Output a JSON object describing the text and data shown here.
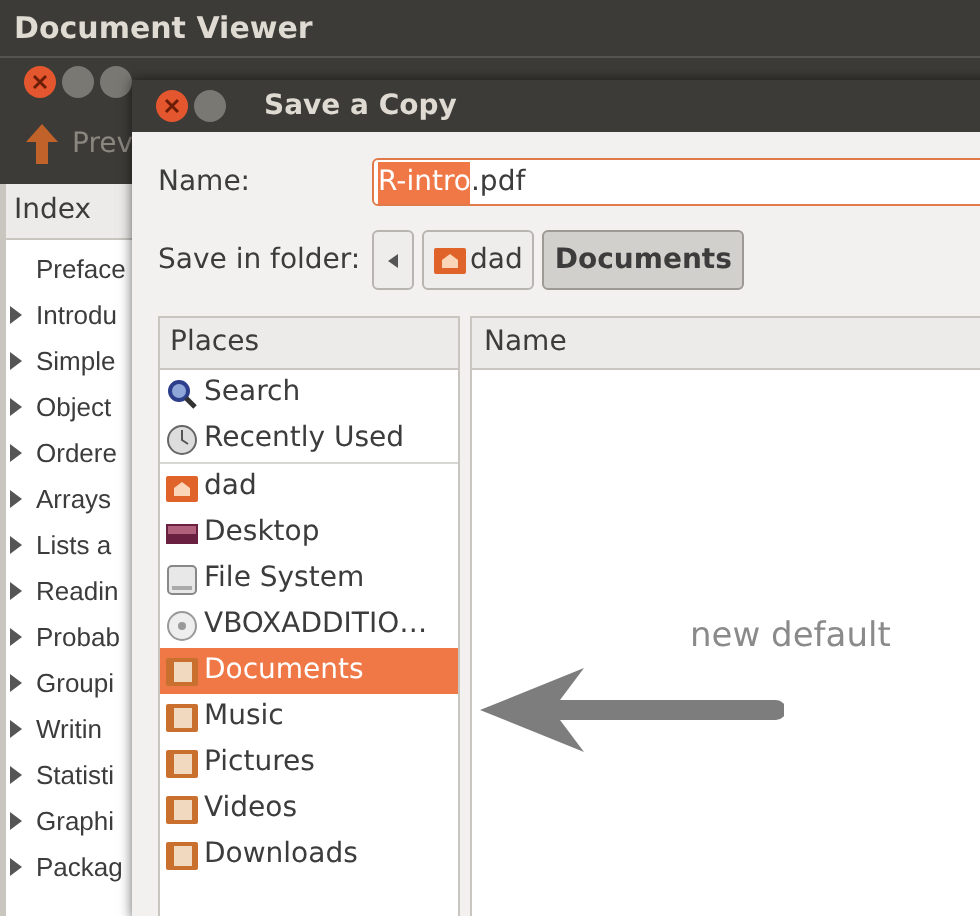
{
  "top_bar": {
    "title": "Document Viewer"
  },
  "back_window": {
    "toolbar": {
      "button": "Prev"
    },
    "sidebar": {
      "header": "Index",
      "items": [
        {
          "label": "Preface",
          "expandable": false
        },
        {
          "label": "Introdu",
          "expandable": true
        },
        {
          "label": "Simple",
          "expandable": true
        },
        {
          "label": "Object",
          "expandable": true
        },
        {
          "label": "Ordere",
          "expandable": true
        },
        {
          "label": "Arrays",
          "expandable": true
        },
        {
          "label": "Lists a",
          "expandable": true
        },
        {
          "label": "Readin",
          "expandable": true
        },
        {
          "label": "Probab",
          "expandable": true
        },
        {
          "label": "Groupi",
          "expandable": true
        },
        {
          "label": "Writin",
          "expandable": true
        },
        {
          "label": "Statisti",
          "expandable": true
        },
        {
          "label": "Graphi",
          "expandable": true
        },
        {
          "label": "Packag",
          "expandable": true
        }
      ]
    }
  },
  "dialog": {
    "title": "Save a Copy",
    "name_label": "Name:",
    "name_selected": "R-intro",
    "name_rest": ".pdf",
    "folder_label": "Save in folder:",
    "path": [
      {
        "label": "dad",
        "kind": "home",
        "selected": false
      },
      {
        "label": "Documents",
        "kind": "plain",
        "selected": true
      }
    ],
    "places_header": "Places",
    "places": [
      {
        "label": "Search",
        "kind": "search",
        "selected": false
      },
      {
        "label": "Recently Used",
        "kind": "recent",
        "selected": false
      },
      {
        "label": "dad",
        "kind": "home",
        "selected": false
      },
      {
        "label": "Desktop",
        "kind": "desktop",
        "selected": false
      },
      {
        "label": "File System",
        "kind": "drive",
        "selected": false
      },
      {
        "label": "VBOXADDITIO…",
        "kind": "disc",
        "selected": false
      },
      {
        "label": "Documents",
        "kind": "folder",
        "selected": true
      },
      {
        "label": "Music",
        "kind": "folder",
        "selected": false
      },
      {
        "label": "Pictures",
        "kind": "folder",
        "selected": false
      },
      {
        "label": "Videos",
        "kind": "folder",
        "selected": false
      },
      {
        "label": "Downloads",
        "kind": "folder",
        "selected": false
      }
    ],
    "files_header": "Name"
  },
  "annotation": {
    "text": "new default"
  }
}
